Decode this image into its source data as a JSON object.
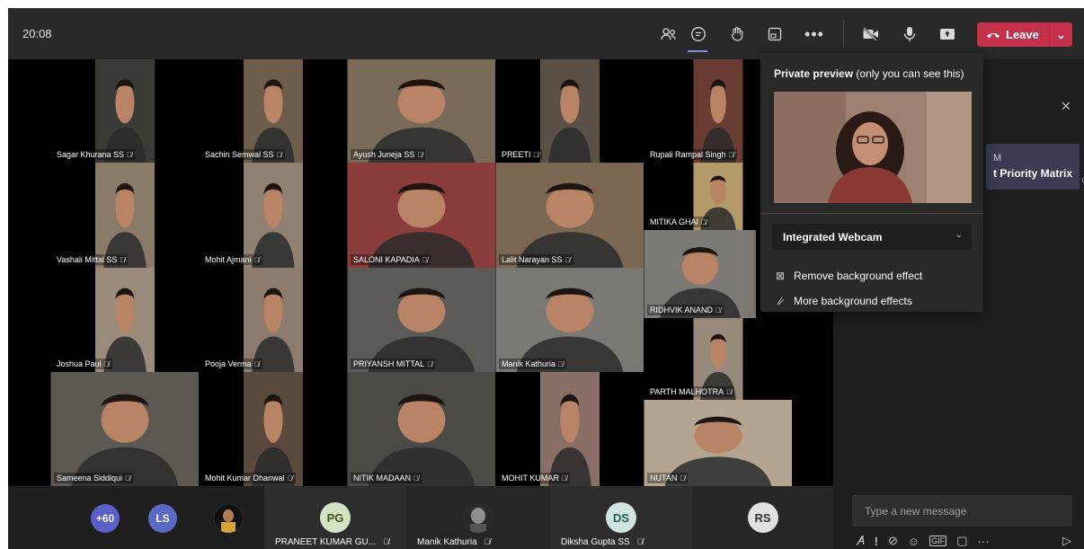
{
  "header": {
    "time": "20:08",
    "leave_label": "Leave"
  },
  "icons": {
    "people": "people-icon",
    "chat": "chat-icon",
    "reactions": "raise-hand-icon",
    "rooms": "rooms-icon",
    "more": "more-icon",
    "camera": "camera-off-icon",
    "mic": "mic-icon",
    "share": "share-icon"
  },
  "colors": {
    "leave": "#c4314b",
    "accent": "#8b8cc7"
  },
  "participants": [
    {
      "name": "Sagar Khurana SS",
      "bg": "#3a3a36"
    },
    {
      "name": "Sachin Semwal SS",
      "bg": "#6e5d4a"
    },
    {
      "name": "Ayush Juneja SS",
      "bg": "#7a6a58"
    },
    {
      "name": "PREETI",
      "bg": "#5a5046"
    },
    {
      "name": "Rupali Rampal Singh",
      "bg": "#6a3b33"
    },
    {
      "name": "Vashali Mittal SS",
      "bg": "#8a7a68"
    },
    {
      "name": "Mohit Ajmani",
      "bg": "#8f8272"
    },
    {
      "name": "SALONI KAPADIA",
      "bg": "#8a3d3a"
    },
    {
      "name": "Lalit Narayan SS",
      "bg": "#7c6852"
    },
    {
      "name": "MITIKA GHAI",
      "bg": "#b39a6b"
    },
    {
      "name": "RIDHVIK ANAND",
      "bg": "#7d7a76"
    },
    {
      "name": "Joshua Paul",
      "bg": "#9a8b7a"
    },
    {
      "name": "Pooja Verma",
      "bg": "#8c7b6e"
    },
    {
      "name": "PRIYANSH MITTAL",
      "bg": "#5c5a57"
    },
    {
      "name": "Manik Kathuria",
      "bg": "#7a7873"
    },
    {
      "name": "PARTH MALHOTRA",
      "bg": "#988a7b"
    },
    {
      "name": "Sameena Siddiqui",
      "bg": "#5d5852"
    },
    {
      "name": "Mohit Kumar Dhanwal",
      "bg": "#5a4a3e"
    },
    {
      "name": "NITIK MADAAN",
      "bg": "#4b4a45"
    },
    {
      "name": "MOHIT KUMAR",
      "bg": "#8a6f67"
    },
    {
      "name": "NUTAN",
      "bg": "#b5a590"
    }
  ],
  "bottom": {
    "overflow": "+60",
    "ls": "LS",
    "pg_initials": "PG",
    "pg_name": "PRANEET KUMAR GU...",
    "manik_name": "Manik Kathuria",
    "ds_initials": "DS",
    "ds_name": "Diksha Gupta SS",
    "rs_initials": "RS"
  },
  "preview": {
    "title_bold": "Private preview",
    "title_rest": " (only you can see this)",
    "device": "Integrated Webcam",
    "remove_bg": "Remove background effect",
    "more_bg": "More background effects"
  },
  "side": {
    "card_l1": "M",
    "card_l2": "t Priority Matrix",
    "compose_placeholder": "Type a new message"
  }
}
